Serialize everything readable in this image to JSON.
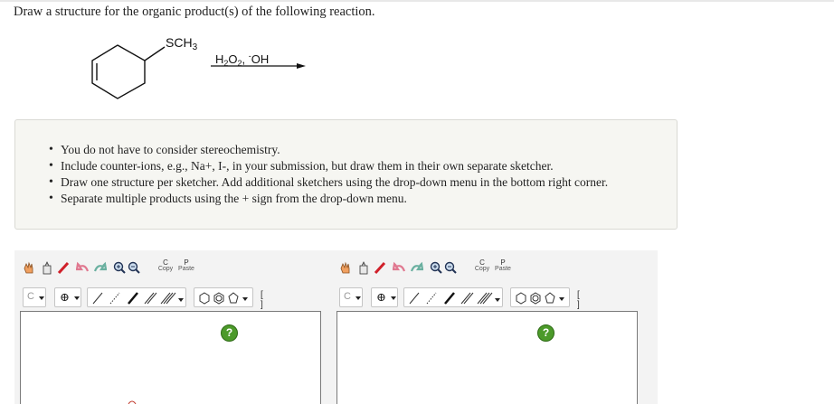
{
  "question": "Draw a structure for the organic product(s) of the following reaction.",
  "reaction": {
    "substituent": "SCH3",
    "reagents": "H2O2, -OH"
  },
  "notes": [
    "You do not have to consider stereochemistry.",
    "Include counter-ions, e.g., Na+, I-, in your submission, but draw them in their own separate sketcher.",
    "Draw one structure per sketcher. Add additional sketchers using the drop-down menu in the bottom right corner.",
    "Separate multiple products using the + sign from the drop-down menu."
  ],
  "toolbar": {
    "copy_label": "Copy",
    "paste_label": "Paste",
    "element_label": "C",
    "bracket_label": "[ ]±",
    "help_label": "?"
  },
  "colors": {
    "help_button": "#4c9a2a",
    "notes_background": "#f6f6f2"
  }
}
